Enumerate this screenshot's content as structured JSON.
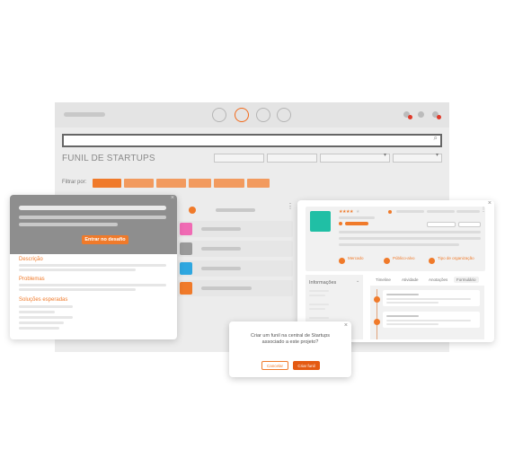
{
  "main": {
    "title": "FUNIL DE STARTUPS",
    "search_icon": "search-icon",
    "search_glyph": "⌕",
    "filter_label": "Filtrar por:",
    "select_chevron": "▾",
    "steps": 4,
    "active_step": 2
  },
  "left_card": {
    "button_label": "Entrar no desafio",
    "close": "×",
    "sections": [
      "Descrição",
      "Problemas",
      "Soluções esperadas"
    ]
  },
  "right_card": {
    "close": "×",
    "stars": "★★★★",
    "empty_star": "★",
    "more": "⋮",
    "attributes": [
      "Mercado",
      "Público-alvo",
      "Tipo de organização"
    ],
    "info_label": "Informações",
    "info_chevron": "⌄",
    "tabs": [
      "Timeline",
      "Atividade",
      "Anotações",
      "Formulário"
    ],
    "active_tab": "Formulário"
  },
  "kanban": {
    "more": "⋮",
    "colors": [
      "#f06bb4",
      "#9a9a9a",
      "#2fa7e0",
      "#f07a2a"
    ]
  },
  "dialog": {
    "message": "Criar um funil na central de Startups associado a este projeto?",
    "cancel_label": "Cancelar",
    "create_label": "Criar funil",
    "close": "×"
  },
  "colors": {
    "accent": "#f07a2a",
    "teal": "#20bfa5",
    "pink": "#f06bb4",
    "blue": "#2fa7e0",
    "red": "#e03a2a"
  }
}
